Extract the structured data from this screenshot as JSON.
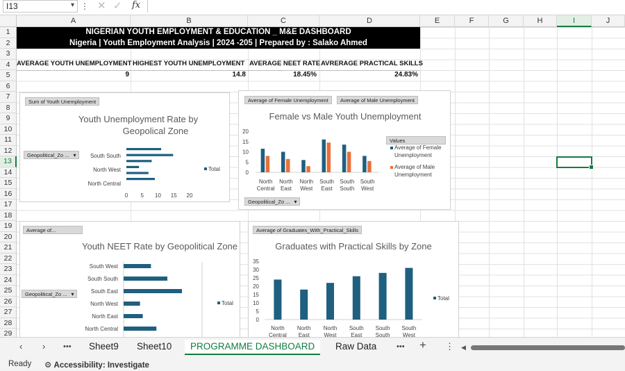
{
  "formula_bar": {
    "name_box": "I13",
    "fx": "fx",
    "formula": ""
  },
  "columns": [
    "A",
    "B",
    "C",
    "D",
    "E",
    "F",
    "G",
    "H",
    "I",
    "J"
  ],
  "rows": [
    "1",
    "2",
    "3",
    "4",
    "5",
    "6",
    "7",
    "8",
    "9",
    "10",
    "11",
    "12",
    "13",
    "14",
    "15",
    "16",
    "17",
    "18",
    "19",
    "20",
    "21",
    "22",
    "23",
    "24",
    "25",
    "26",
    "27",
    "28",
    "29"
  ],
  "banner": {
    "title": "NIGERIAN YOUTH EMPLOYMENT & EDUCATION _ M&E DASHBOARD",
    "subtitle": "Nigeria | Youth Employment Analysis | 2024 -205 | Prepared by : Salako Ahmed"
  },
  "kpis": [
    {
      "label": "AVERAGE YOUTH UNEMPLOYMENT",
      "value": "9"
    },
    {
      "label": "HIGHEST YOUTH UNEMPLOYMENT",
      "value": "14.8"
    },
    {
      "label": "AVERAGE NEET RATE",
      "value": "18.45%"
    },
    {
      "label": "AVRERAGE PRACTICAL SKILLS",
      "value": "24.83%"
    }
  ],
  "chart_data": [
    {
      "type": "bar",
      "orientation": "horizontal",
      "title": "Youth Unemployment Rate by Geopolical Zone",
      "field_button": "Sum of Youth Unemployment",
      "filter_button": "Geopolitical_Zo ...",
      "categories": [
        "North Central",
        "",
        "North West",
        "",
        "South South",
        ""
      ],
      "values": [
        9,
        7,
        4,
        8,
        14.8,
        11
      ],
      "visible_labels": [
        "South South",
        "North West",
        "North Central"
      ],
      "xticks": [
        "0",
        "5",
        "10",
        "15",
        "20"
      ],
      "xlim": [
        0,
        20
      ],
      "legend": [
        "Total"
      ],
      "color": "#1f5f7f"
    },
    {
      "type": "bar",
      "title": "Female vs Male Youth Unemployment",
      "field_buttons": [
        "Average of Female Unemployment",
        "Average of Male Unemployment"
      ],
      "filter_button": "Geopolitical_Zo ...",
      "legend_title": "Values",
      "categories": [
        [
          "North",
          "Central"
        ],
        [
          "North",
          "East"
        ],
        [
          "North",
          "West"
        ],
        [
          "South",
          "East"
        ],
        [
          "South",
          "South"
        ],
        [
          "South",
          "West"
        ]
      ],
      "series": [
        {
          "name": "Average of Female Unemployment",
          "color": "#1f5f7f",
          "values": [
            11.5,
            10,
            6,
            16,
            13.5,
            8
          ]
        },
        {
          "name": "Average of Male Unemployment",
          "color": "#e8703a",
          "values": [
            8,
            6.5,
            3,
            14.5,
            10,
            5.5
          ]
        }
      ],
      "yticks": [
        "0",
        "5",
        "10",
        "15",
        "20"
      ],
      "ylim": [
        0,
        20
      ]
    },
    {
      "type": "bar",
      "orientation": "horizontal",
      "title": "Youth NEET Rate by Geopolitical Zone",
      "field_button": "Average of...",
      "filter_button": "Geopolitical_Zo ...",
      "categories": [
        "South West",
        "South South",
        "South East",
        "North West",
        "North East",
        "North Central"
      ],
      "values": [
        15,
        24,
        32,
        9,
        10.5,
        18
      ],
      "xlim": [
        0,
        40
      ],
      "legend": [
        "Total"
      ],
      "color": "#1f5f7f"
    },
    {
      "type": "bar",
      "title": "Graduates with Practical Skills by Zone",
      "field_button": "Average of Graduates_With_Practical_Skills",
      "categories": [
        [
          "North",
          "Central"
        ],
        [
          "North",
          "East"
        ],
        [
          "North",
          "West"
        ],
        [
          "South",
          "East"
        ],
        [
          "South",
          "South"
        ],
        [
          "South",
          "West"
        ]
      ],
      "values": [
        24,
        18,
        22,
        26,
        28,
        31
      ],
      "yticks": [
        "0",
        "5",
        "10",
        "15",
        "20",
        "25",
        "30",
        "35"
      ],
      "ylim": [
        0,
        35
      ],
      "legend": [
        "Total"
      ],
      "color": "#1f5f7f"
    }
  ],
  "sheet_tabs": {
    "tabs": [
      "Sheet9",
      "Sheet10",
      "PROGRAMME DASHBOARD",
      "Raw Data"
    ],
    "active": "PROGRAMME DASHBOARD",
    "more": "•••",
    "add": "+",
    "menu": "⋮",
    "prev": "‹",
    "next": "›"
  },
  "status_bar": {
    "ready": "Ready",
    "accessibility": "Accessibility: Investigate"
  }
}
